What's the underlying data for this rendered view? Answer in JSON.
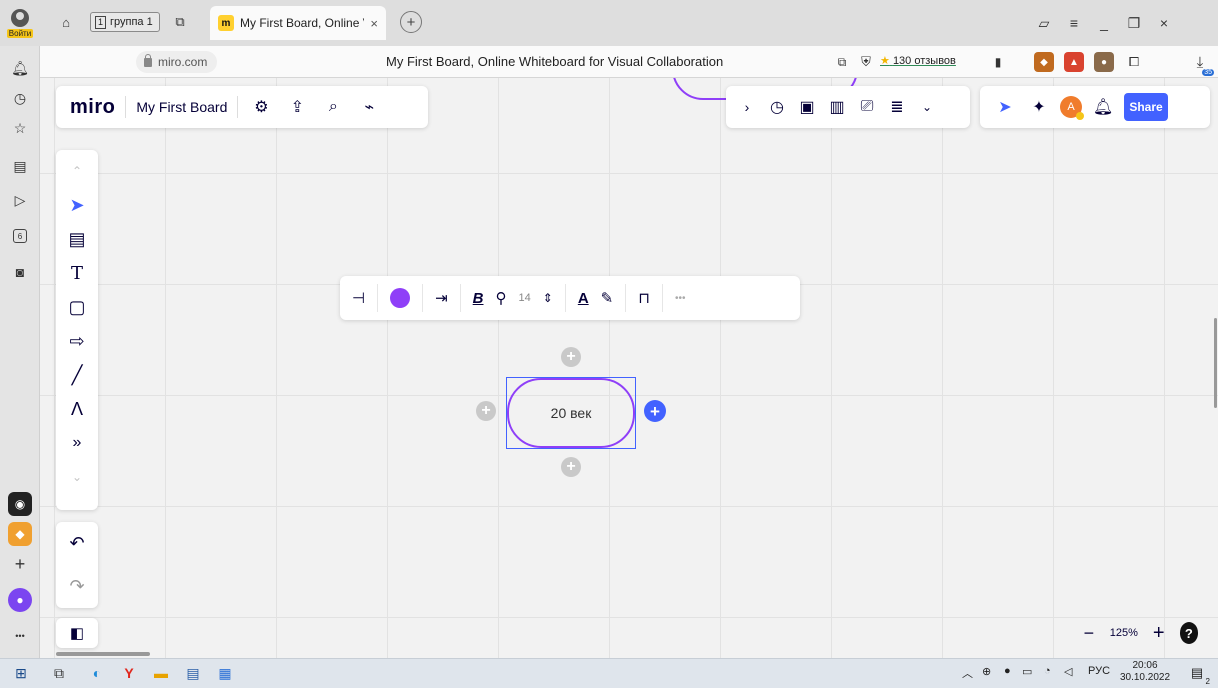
{
  "browser": {
    "login_label": "Войти",
    "group_number": "1",
    "group_label": "группа 1",
    "tab_title": "My First Board, Online V",
    "tab_close": "×",
    "new_tab": "+",
    "url": "miro.com",
    "page_title": "My First Board, Online Whiteboard for Visual Collaboration",
    "reviews": "130 отзывов",
    "download_count": "35",
    "sidebar_badge_6": "6",
    "more": "•••"
  },
  "miro": {
    "logo": "miro",
    "board_name": "My First Board",
    "share_label": "Share",
    "user_initial": "A",
    "zoom_level": "125%",
    "help": "?",
    "font_size": "14",
    "shape_text": "20 век",
    "text_tool": "T"
  },
  "colors": {
    "accent": "#4262ff",
    "shape_border": "#8f3ff8",
    "miro_yellow": "#ffd02f"
  },
  "taskbar": {
    "lang": "РУС",
    "time": "20:06",
    "date": "30.10.2022",
    "notifications": "2"
  }
}
